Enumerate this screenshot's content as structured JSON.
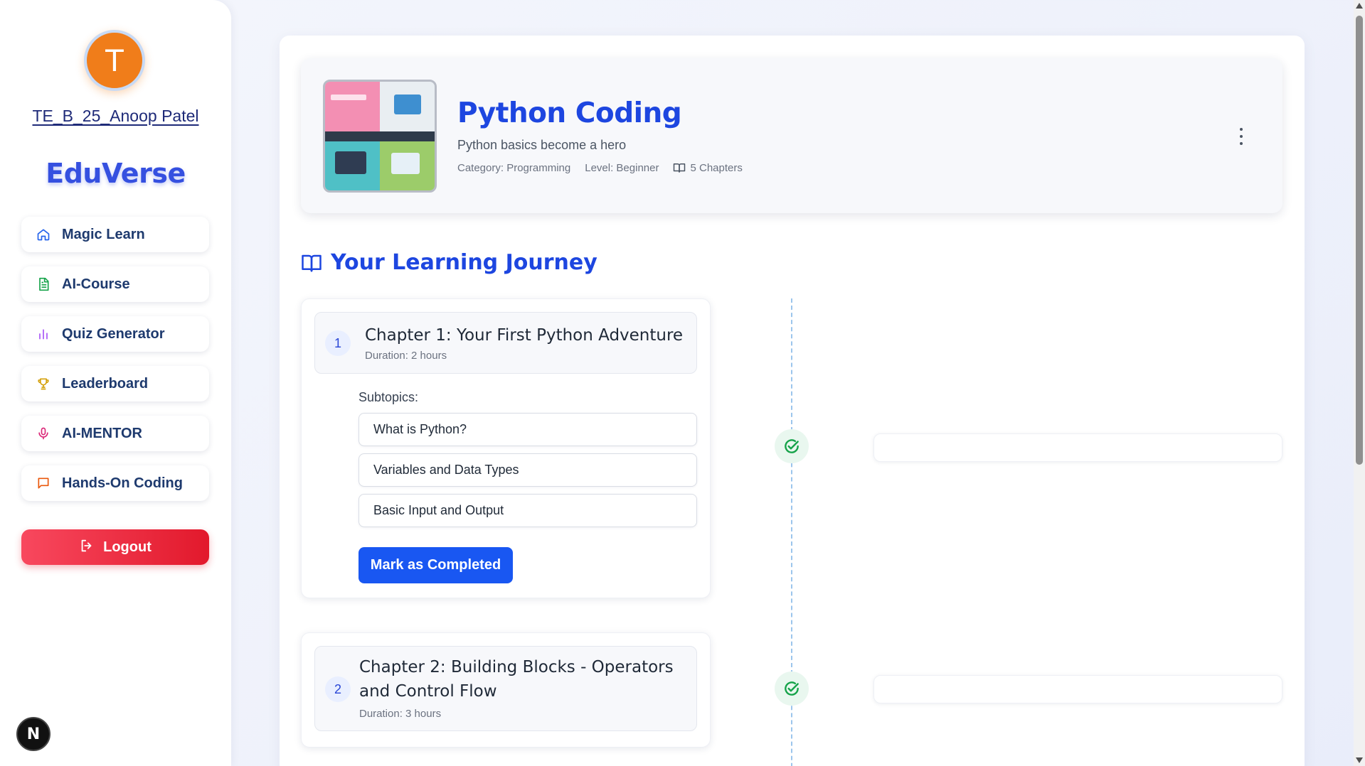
{
  "user": {
    "initial": "T",
    "name": "TE_B_25_Anoop Patel"
  },
  "brand": "EduVerse",
  "nav": {
    "items": [
      {
        "label": "Magic Learn",
        "icon": "home-icon",
        "color": "#2563eb"
      },
      {
        "label": "AI-Course",
        "icon": "document-icon",
        "color": "#16a34a"
      },
      {
        "label": "Quiz Generator",
        "icon": "bar-chart-icon",
        "color": "#a855f7"
      },
      {
        "label": "Leaderboard",
        "icon": "trophy-icon",
        "color": "#d4a00b"
      },
      {
        "label": "AI-MENTOR",
        "icon": "microphone-icon",
        "color": "#db2777"
      },
      {
        "label": "Hands-On Coding",
        "icon": "chat-icon",
        "color": "#ea580c"
      }
    ],
    "logout_label": "Logout"
  },
  "course": {
    "title": "Python Coding",
    "subtitle": "Python basics become a hero",
    "category": "Category: Programming",
    "level": "Level: Beginner",
    "chapters_count": "5 Chapters"
  },
  "journey": {
    "title": "Your Learning Journey"
  },
  "chapters": [
    {
      "number": "1",
      "title": "Chapter 1: Your First Python Adventure",
      "duration": "Duration: 2 hours",
      "subtopics_label": "Subtopics:",
      "subtopics": [
        "What is Python?",
        "Variables and Data Types",
        "Basic Input and Output"
      ],
      "action_label": "Mark as Completed",
      "status": "completed"
    },
    {
      "number": "2",
      "title": "Chapter 2: Building Blocks - Operators and Control Flow",
      "duration": "Duration: 3 hours",
      "status": "completed"
    }
  ],
  "dev_badge": "N",
  "colors": {
    "accent": "#1d46e0",
    "button": "#1957f2",
    "logout": "#e2192c",
    "avatar": "#f07d1a",
    "timeline_check": "#16a34a"
  }
}
